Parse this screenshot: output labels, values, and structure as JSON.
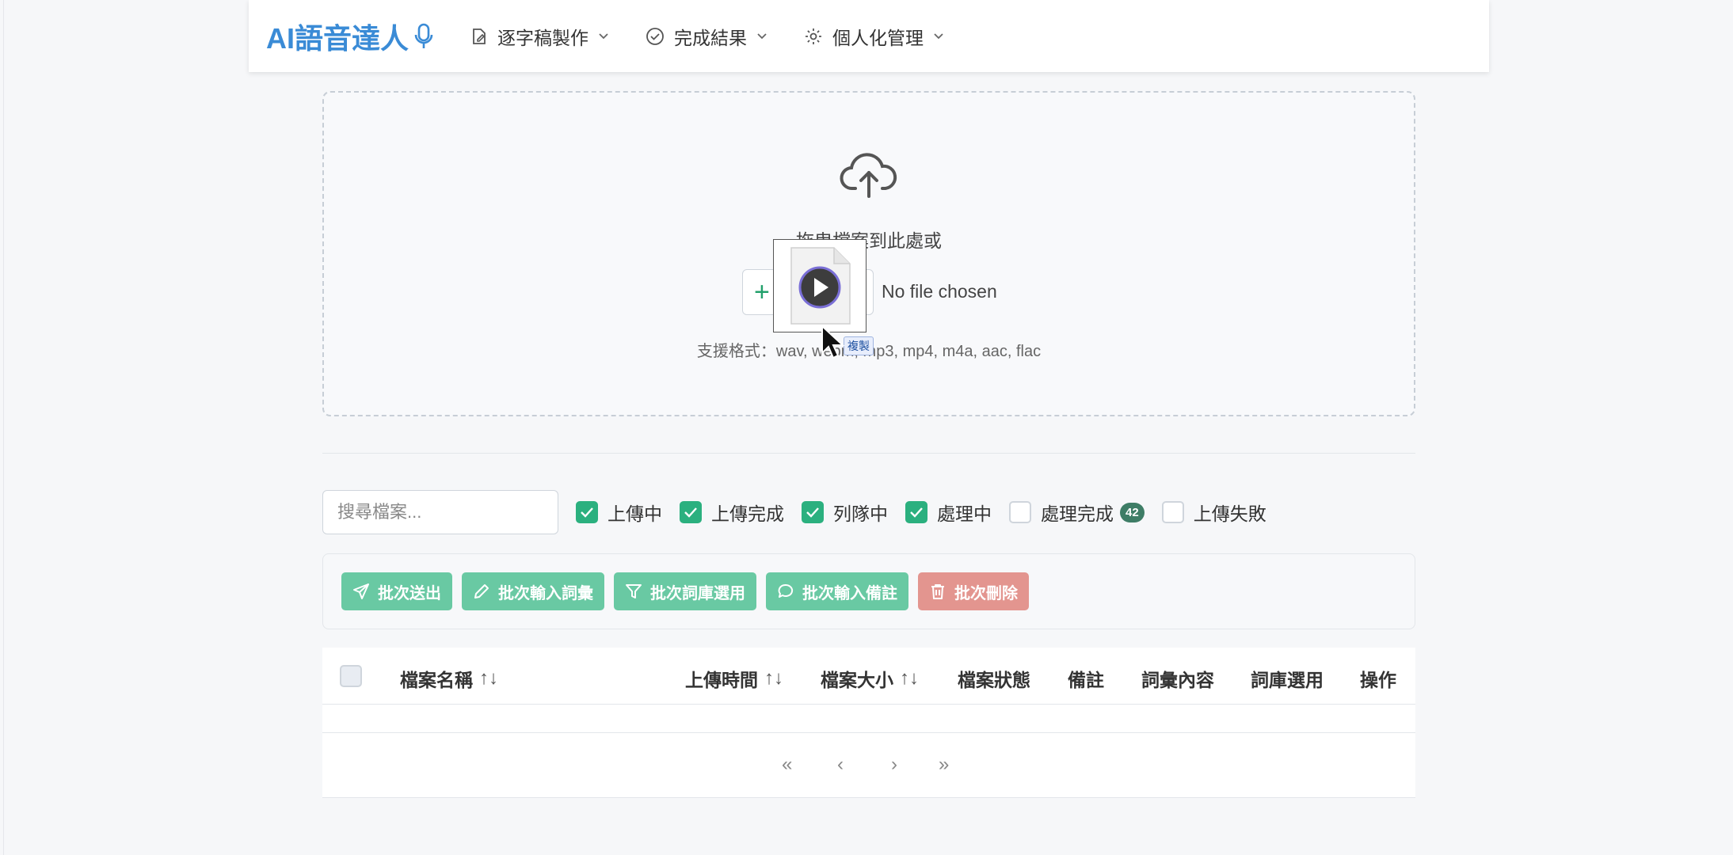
{
  "navbar": {
    "brand": "AI語音達人",
    "items": [
      {
        "label": "逐字稿製作",
        "icon": "edit-icon"
      },
      {
        "label": "完成結果",
        "icon": "check-circle-icon"
      },
      {
        "label": "個人化管理",
        "icon": "gear-icon"
      }
    ]
  },
  "upload": {
    "drop_text": "拖曳檔案到此處或",
    "choose_symbol": "+",
    "no_file": "No file chosen",
    "formats": "支援格式：wav, webm, mp3, mp4, m4a, aac, flac",
    "drag_badge": "複製"
  },
  "search": {
    "placeholder": "搜尋檔案..."
  },
  "filters": [
    {
      "label": "上傳中",
      "checked": true
    },
    {
      "label": "上傳完成",
      "checked": true
    },
    {
      "label": "列隊中",
      "checked": true
    },
    {
      "label": "處理中",
      "checked": true
    },
    {
      "label": "處理完成",
      "checked": false,
      "badge": "42"
    },
    {
      "label": "上傳失敗",
      "checked": false
    }
  ],
  "batch": {
    "send": "批次送出",
    "input_vocab": "批次輸入詞彙",
    "select_lexicon": "批次詞庫選用",
    "input_note": "批次輸入備註",
    "delete": "批次刪除"
  },
  "table": {
    "columns": {
      "name": "檔案名稱",
      "upload_time": "上傳時間",
      "size": "檔案大小",
      "status": "檔案狀態",
      "note": "備註",
      "vocab": "詞彙內容",
      "lexicon": "詞庫選用",
      "actions": "操作"
    },
    "sort_symbol": "↑↓"
  },
  "pagination": {
    "first": "«",
    "prev": "‹",
    "next": "›",
    "last": "»"
  },
  "colors": {
    "brand": "#3a8bd6",
    "accent_green": "#2bb07f",
    "batch_green": "#69c9a3",
    "danger": "#e3958f"
  }
}
